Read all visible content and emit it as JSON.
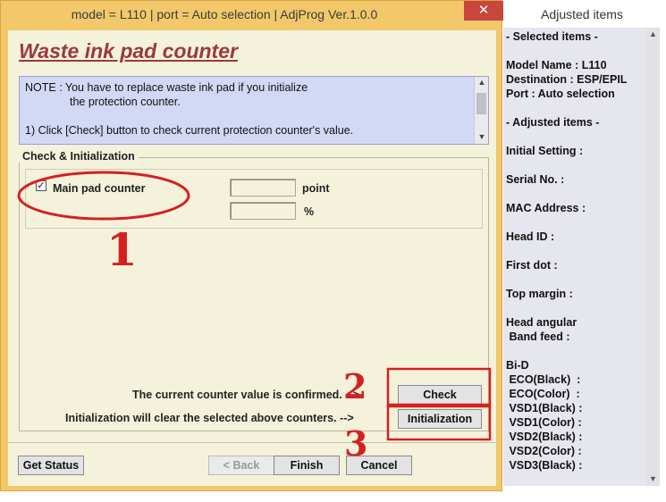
{
  "window": {
    "title": "model = L110 | port = Auto selection | AdjProg Ver.1.0.0",
    "close_glyph": "✕"
  },
  "heading": "Waste ink pad counter",
  "note": {
    "line1": "NOTE : You have to replace waste ink pad if you initialize",
    "line2": "the protection counter.",
    "line3": "1) Click [Check] button to check current protection counter's value."
  },
  "group": {
    "legend": "Check & Initialization",
    "checkbox_label": "Main pad counter",
    "checkbox_checked": true,
    "point_value": "",
    "percent_value": "",
    "unit_point": "point",
    "unit_percent": "%"
  },
  "instructions": {
    "confirm": "The current counter value is confirmed. -->",
    "init": "Initialization will clear the selected above counters. -->"
  },
  "buttons": {
    "check": "Check",
    "initialization": "Initialization",
    "get_status": "Get Status",
    "back": "< Back",
    "finish": "Finish",
    "cancel": "Cancel"
  },
  "panel": {
    "title": "Adjusted items",
    "lines": [
      "- Selected items -",
      "",
      "Model Name : L110",
      "Destination : ESP/EPIL",
      "Port : Auto selection",
      "",
      "- Adjusted items -",
      "",
      "Initial Setting :",
      "",
      "Serial No. :",
      "",
      "MAC Address :",
      "",
      "Head ID :",
      "",
      "First dot :",
      "",
      "Top margin :",
      "",
      "Head angular",
      " Band feed :",
      "",
      "Bi-D",
      " ECO(Black)  :",
      " ECO(Color)  :",
      " VSD1(Black) :",
      " VSD1(Color) :",
      " VSD2(Black) :",
      " VSD2(Color) :",
      " VSD3(Black) :"
    ]
  },
  "annotations": {
    "marker1": "1",
    "marker2": "2",
    "marker3": "3",
    "color": "#d62020"
  }
}
